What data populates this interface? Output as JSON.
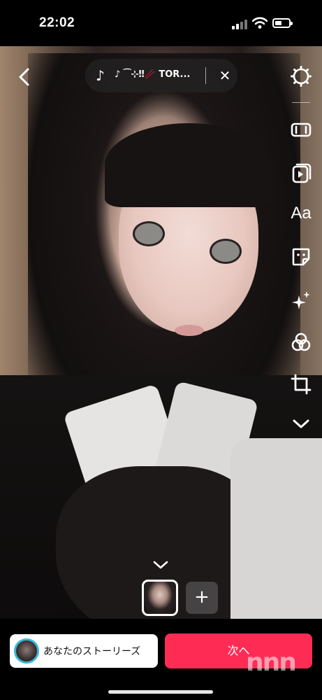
{
  "status_bar": {
    "time": "22:02"
  },
  "editor": {
    "music": {
      "title": "♪ ⁀⊹‼︎🥢 TOR...",
      "note_icon": "music-note-icon",
      "close_icon": "close-icon"
    },
    "tools": [
      {
        "name": "settings",
        "icon": "gear-icon"
      },
      {
        "name": "trim",
        "icon": "trim-icon"
      },
      {
        "name": "media",
        "icon": "media-icon"
      },
      {
        "name": "text",
        "icon": "text-icon",
        "label": "Aa"
      },
      {
        "name": "sticker",
        "icon": "sticker-icon"
      },
      {
        "name": "effects",
        "icon": "sparkle-icon"
      },
      {
        "name": "filters",
        "icon": "filter-icon"
      },
      {
        "name": "crop",
        "icon": "crop-icon"
      },
      {
        "name": "more",
        "icon": "chevron-down-icon"
      }
    ],
    "add_clip_label": "+"
  },
  "bottom": {
    "story_label": "あなたのストーリーズ",
    "next_label": "次へ",
    "watermark": "nnn"
  },
  "colors": {
    "accent": "#fe2c55",
    "story_ring": "#38b8d8"
  }
}
